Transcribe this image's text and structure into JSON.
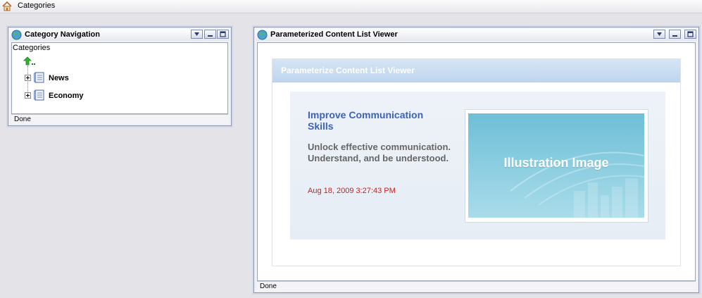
{
  "breadcrumb": {
    "label": "Categories"
  },
  "category_nav": {
    "title": "Category Navigation",
    "tree_header": "Categories",
    "items": [
      {
        "label": "News"
      },
      {
        "label": "Economy"
      }
    ],
    "status": "Done"
  },
  "content_viewer": {
    "title": "Parameterized Content List Viewer",
    "header": "Parameterize Content List Viewer",
    "article": {
      "headline": "Improve Communication Skills",
      "summary": "Unlock effective communication. Understand, and be understood.",
      "date": "Aug 18, 2009 3:27:43 PM",
      "image_label": "Illustration Image"
    },
    "status": "Done"
  },
  "colors": {
    "headline": "#3a62bd",
    "date": "#cc1c1c",
    "header_bg": "#c9dcf1",
    "image_bg": "#7cc3d9"
  }
}
